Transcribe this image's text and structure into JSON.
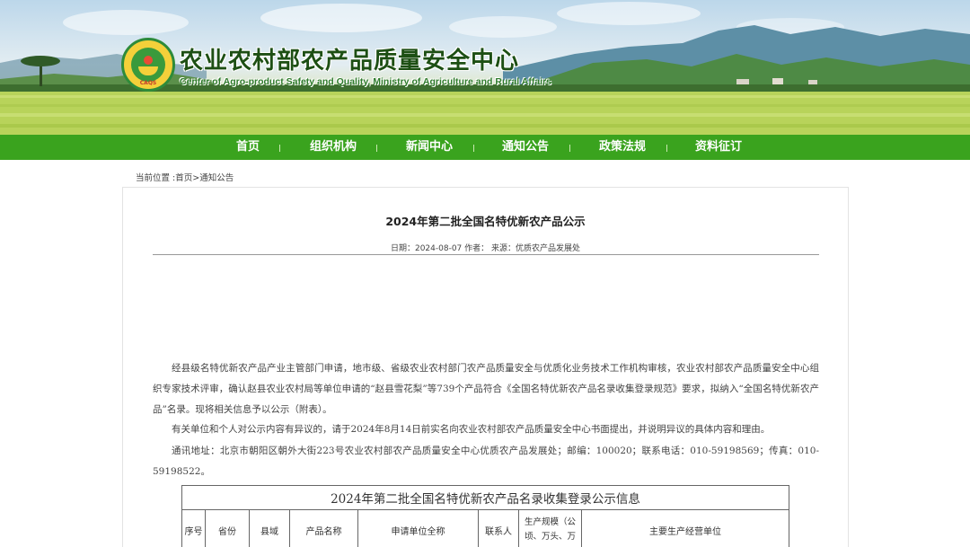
{
  "site": {
    "title": "农业农村部农产品质量安全中心",
    "subtitle": "Center of Agro-product Safety and Quality, Ministry of Agriculture and Rural Affairs",
    "logo_text": "CAQS"
  },
  "nav": {
    "items": [
      "首页",
      "组织机构",
      "新闻中心",
      "通知公告",
      "政策法规",
      "资料征订"
    ]
  },
  "breadcrumb": {
    "prefix": "当前位置 :",
    "home": "首页",
    "sep": ">",
    "current": "通知公告"
  },
  "article": {
    "title": "2024年第二批全国名特优新农产品公示",
    "meta": "日期：2024-08-07 作者： 来源：优质农产品发展处",
    "paragraphs": [
      "经县级名特优新农产品产业主管部门申请，地市级、省级农业农村部门农产品质量安全与优质化业务技术工作机构审核，农业农村部农产品质量安全中心组织专家技术评审，确认赵县农业农村局等单位申请的“赵县雪花梨”等739个产品符合《全国名特优新农产品名录收集登录规范》要求，拟纳入“全国名特优新农产品”名录。现将相关信息予以公示（附表）。",
      "有关单位和个人对公示内容有异议的，请于2024年8月14日前实名向农业农村部农产品质量安全中心书面提出，并说明异议的具体内容和理由。",
      "通讯地址：北京市朝阳区朝外大街223号农业农村部农产品质量安全中心优质农产品发展处；邮编：100020；联系电话：010-59198569；传真：010-59198522。"
    ]
  },
  "table": {
    "caption": "2024年第二批全国名特优新农产品名录收集登录公示信息",
    "headers": [
      "序号",
      "省份",
      "县域",
      "产品名称",
      "申请单位全称",
      "联系人",
      "生产规模（公顷、万头、万",
      "主要生产经营单位"
    ]
  }
}
